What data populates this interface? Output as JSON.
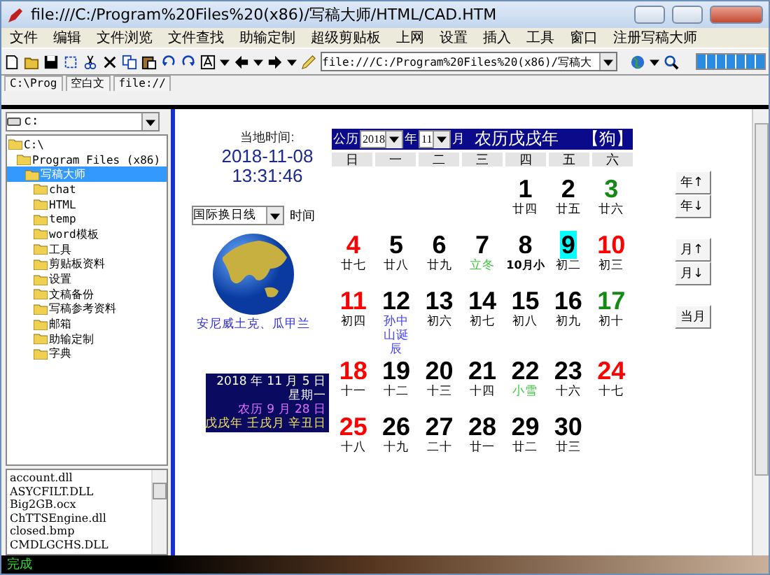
{
  "window": {
    "title": "file:///C:/Program%20Files%20(x86)/写稿大师/HTML/CAD.HTM"
  },
  "menu": [
    "文件",
    "编辑",
    "文件浏览",
    "文件查找",
    "助输定制",
    "超级剪贴板",
    "上网",
    "设置",
    "插入",
    "工具",
    "窗口",
    "注册写稿大师"
  ],
  "address": {
    "value": "file:///C:/Program%20Files%20(x86)/写稿大"
  },
  "progress": {
    "level": 1
  },
  "tabs": [
    {
      "label": "C:\\Prog"
    },
    {
      "label": "空白文"
    },
    {
      "label": "file://"
    }
  ],
  "drive": {
    "value": "c:"
  },
  "tree": [
    {
      "label": "C:\\",
      "children": [
        {
          "label": "Program Files (x86)",
          "children": [
            {
              "label": "写稿大师",
              "selected": true,
              "children": [
                {
                  "label": "chat",
                  "selected": false
                },
                {
                  "label": "HTML",
                  "selected": false
                },
                {
                  "label": "temp",
                  "selected": false
                },
                {
                  "label": "word模板",
                  "selected": false
                },
                {
                  "label": "工具",
                  "selected": false
                },
                {
                  "label": "剪贴板资料",
                  "selected": false
                },
                {
                  "label": "设置",
                  "selected": false
                },
                {
                  "label": "文稿备份",
                  "selected": false
                },
                {
                  "label": "写稿参考资料",
                  "selected": false
                },
                {
                  "label": "邮箱",
                  "selected": false
                },
                {
                  "label": "助输定制",
                  "selected": false
                },
                {
                  "label": "字典",
                  "selected": false
                }
              ]
            }
          ]
        }
      ]
    }
  ],
  "files": [
    "account.dll",
    "ASYCFILT.DLL",
    "Big2GB.ocx",
    "ChTTSEngine.dll",
    "closed.bmp",
    "CMDLGCHS.DLL"
  ],
  "status_bar": "完成",
  "clock": {
    "label": "当地时间:",
    "date": "2018-11-08",
    "time": "13:31:46"
  },
  "timezone": {
    "value": "国际换日线",
    "label": "时间",
    "place": "安尼威土克、瓜甲兰"
  },
  "calendar": {
    "solar_label": "公历",
    "year": "2018",
    "year_unit": "年",
    "month": "11",
    "month_unit": "月",
    "lunar_year": "农历戊戌年",
    "zodiac": "【狗】",
    "weekdays": [
      "日",
      "一",
      "二",
      "三",
      "四",
      "五",
      "六"
    ],
    "weeks": [
      [
        {
          "day": "1",
          "lunar": "廿四",
          "kind": "normal",
          "selected": false
        },
        {
          "day": "2",
          "lunar": "廿五",
          "kind": "normal",
          "selected": false
        },
        {
          "day": "3",
          "lunar": "廿六",
          "color": "#138a13",
          "kind": "normal",
          "selected": false
        }
      ],
      [
        {
          "day": "4",
          "lunar": "廿七",
          "color": "#ff0000",
          "kind": "normal",
          "selected": false
        },
        {
          "day": "5",
          "lunar": "廿八",
          "kind": "normal",
          "selected": false
        },
        {
          "day": "6",
          "lunar": "廿九",
          "kind": "normal",
          "selected": false
        },
        {
          "day": "7",
          "lunar": "立冬",
          "kind": "solar_term",
          "selected": false
        },
        {
          "day": "8",
          "lunar": "10月小",
          "kind": "month_start",
          "selected": false
        },
        {
          "day": "9",
          "lunar": "初二",
          "kind": "normal",
          "selected": true
        },
        {
          "day": "10",
          "lunar": "初三",
          "color": "#ff0000",
          "kind": "normal",
          "selected": false
        }
      ],
      [
        {
          "day": "11",
          "lunar": "初四",
          "color": "#ff0000",
          "kind": "normal",
          "selected": false
        },
        {
          "day": "12",
          "lunar": "孙中山诞辰",
          "kind": "festival",
          "selected": false
        },
        {
          "day": "13",
          "lunar": "初六",
          "kind": "normal",
          "selected": false
        },
        {
          "day": "14",
          "lunar": "初七",
          "kind": "normal",
          "selected": false
        },
        {
          "day": "15",
          "lunar": "初八",
          "kind": "normal",
          "selected": false
        },
        {
          "day": "16",
          "lunar": "初九",
          "kind": "normal",
          "selected": false
        },
        {
          "day": "17",
          "lunar": "初十",
          "color": "#138a13",
          "kind": "normal",
          "selected": false
        }
      ],
      [
        {
          "day": "18",
          "lunar": "十一",
          "color": "#ff0000",
          "kind": "normal",
          "selected": false
        },
        {
          "day": "19",
          "lunar": "十二",
          "kind": "normal",
          "selected": false
        },
        {
          "day": "20",
          "lunar": "十三",
          "kind": "normal",
          "selected": false
        },
        {
          "day": "21",
          "lunar": "十四",
          "kind": "normal",
          "selected": false
        },
        {
          "day": "22",
          "lunar": "小雪",
          "kind": "solar_term",
          "selected": false
        },
        {
          "day": "23",
          "lunar": "十六",
          "kind": "normal",
          "selected": false
        },
        {
          "day": "24",
          "lunar": "十七",
          "color": "#ff0000",
          "kind": "normal",
          "selected": false
        }
      ],
      [
        {
          "day": "25",
          "lunar": "十八",
          "color": "#ff0000",
          "kind": "normal",
          "selected": false
        },
        {
          "day": "26",
          "lunar": "十九",
          "kind": "normal",
          "selected": false
        },
        {
          "day": "27",
          "lunar": "二十",
          "kind": "normal",
          "selected": false
        },
        {
          "day": "28",
          "lunar": "廿一",
          "kind": "normal",
          "selected": false
        },
        {
          "day": "29",
          "lunar": "廿二",
          "kind": "normal",
          "selected": false
        },
        {
          "day": "30",
          "lunar": "廿三",
          "kind": "normal",
          "selected": false
        }
      ]
    ],
    "nav_buttons": [
      [
        "年↑",
        "年↓"
      ],
      [
        "月↑",
        "月↓"
      ],
      [
        "当月"
      ]
    ]
  },
  "tooltip": [
    {
      "text": "2018 年 11 月 5 日",
      "color": "#ffffff"
    },
    {
      "text": "星期一",
      "color": "#ffffff"
    },
    {
      "text": "农历 9 月 28 日",
      "color": "#e070ff"
    },
    {
      "text": "戊戌年 壬戌月 辛丑日",
      "color": "#f0e060"
    }
  ]
}
